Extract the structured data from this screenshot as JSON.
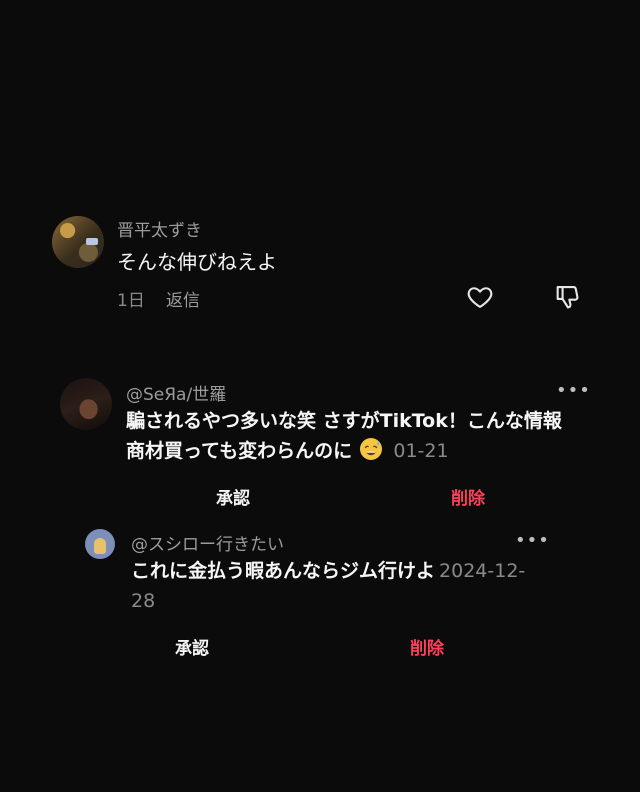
{
  "comments": [
    {
      "username": "晋平太ずき",
      "text": "そんな伸びねえよ",
      "time": "1日",
      "reply_label": "返信",
      "icons": {
        "like": "heart-outline-icon",
        "dislike": "thumbs-down-outline-icon"
      }
    },
    {
      "username": "@SeЯa/世羅",
      "text": "騙されるやつ多いな笑 さすがTikTok！こんな情報商材買っても変わらんのに",
      "emoji": "sweat-smile-emoji",
      "date": "01-21",
      "more": "•••",
      "approve_label": "承認",
      "delete_label": "削除"
    },
    {
      "username": "@スシロー行きたい",
      "text": "これに金払う暇あんならジム行けよ",
      "date": "2024-12-28",
      "more": "•••",
      "approve_label": "承認",
      "delete_label": "削除"
    }
  ],
  "colors": {
    "background": "#0b0b0b",
    "primary_text": "#f4f4f4",
    "secondary_text": "#9c9c9c",
    "delete_red": "#ff3e5a"
  }
}
